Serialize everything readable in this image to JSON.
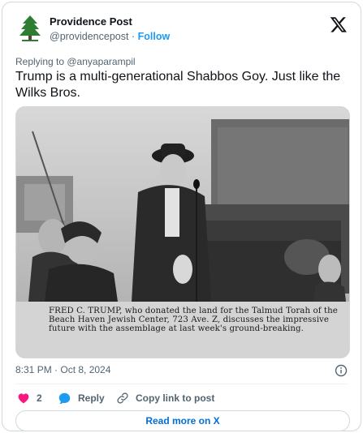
{
  "account": {
    "name": "Providence Post",
    "handle": "@providencepost",
    "separator": "·",
    "follow_label": "Follow"
  },
  "reply": {
    "replying_to_label": "Replying to @anyaparampil"
  },
  "tweet": {
    "text": "Trump is a multi-generational Shabbos Goy.  Just like the Wilks Bros.",
    "timestamp": "8:31 PM · Oct 8, 2024"
  },
  "media": {
    "caption": "FRED C. TRUMP, who donated the land for the Talmud Torah of the Beach Haven Jewish Center, 723 Ave. Z, discusses the impressive future with the assemblage at last week's ground-breaking."
  },
  "actions": {
    "like_count": "2",
    "reply_label": "Reply",
    "copy_link_label": "Copy link to post"
  },
  "footer": {
    "read_more_label": "Read more on X"
  },
  "colors": {
    "accent": "#1d9bf0",
    "link": "#006fd6",
    "like": "#f91880",
    "muted": "#536471",
    "avatar_tree": "#2e7d32"
  },
  "icons": {
    "avatar": "pine-tree-icon",
    "logo": "x-logo-icon",
    "info": "info-circle-icon",
    "like": "heart-icon",
    "reply": "speech-bubble-icon",
    "copy": "link-icon"
  }
}
